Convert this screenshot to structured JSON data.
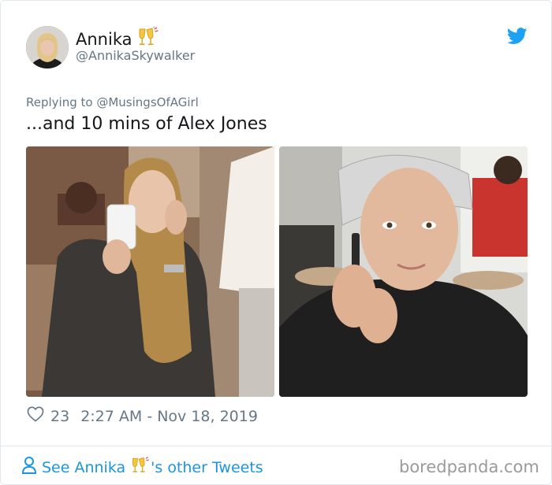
{
  "tweet": {
    "display_name": "Annika",
    "handle": "@AnnikaSkywalker",
    "replying_label": "Replying to",
    "replying_mention": "@MusingsOfAGirl",
    "text": "...and 10 mins of Alex Jones",
    "likes": "23",
    "timestamp": "2:27 AM - Nov 18, 2019"
  },
  "footer": {
    "see_prefix": "See Annika",
    "see_suffix": "'s other Tweets"
  },
  "watermark": "boredpanda.com",
  "colors": {
    "twitter_blue": "#1da1f2",
    "link_blue": "#1b95e0",
    "muted": "#657786"
  },
  "icons": {
    "brand": "twitter-bird-icon",
    "name_emoji": "clinking-glasses-emoji",
    "like": "heart-outline-icon",
    "profile": "person-outline-icon"
  }
}
